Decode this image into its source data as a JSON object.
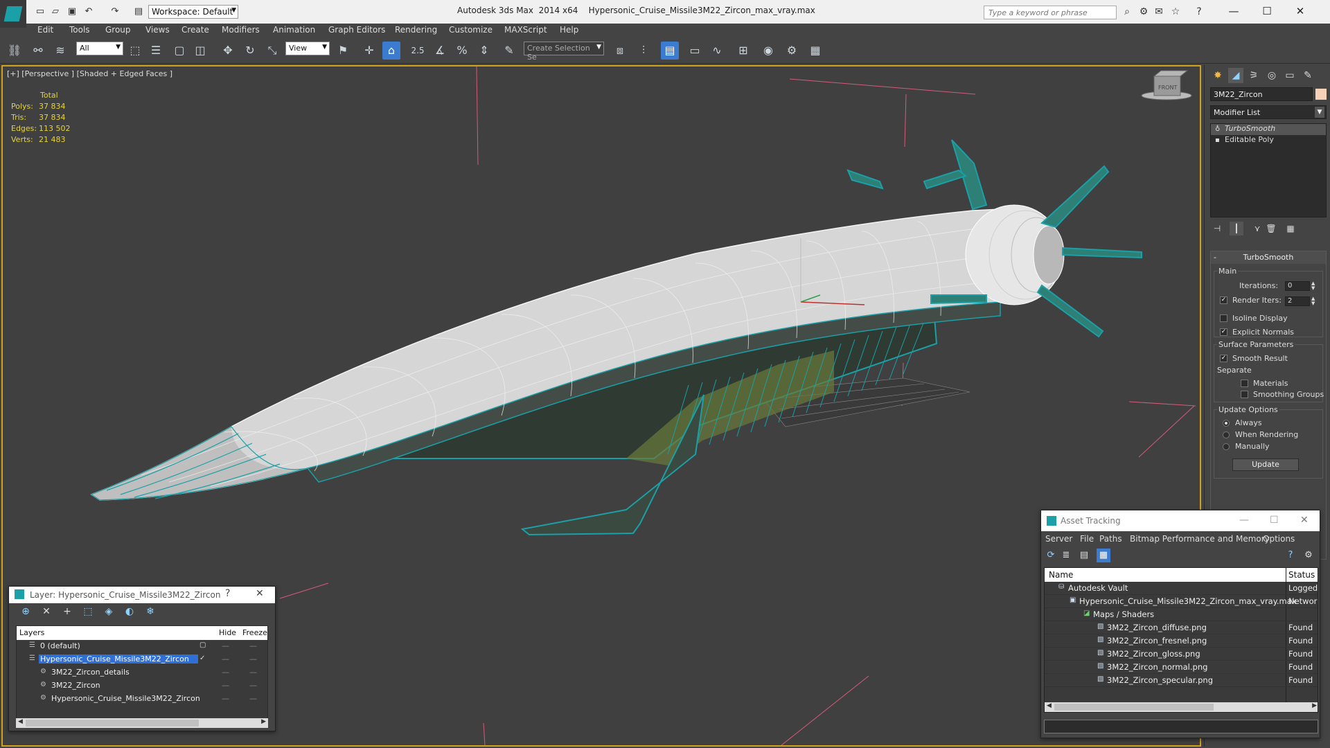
{
  "app": {
    "title": "Autodesk 3ds Max  2014 x64",
    "file": "Hypersonic_Cruise_Missile3M22_Zircon_max_vray.max",
    "workspace": "Workspace: Default",
    "search_placeholder": "Type a keyword or phrase"
  },
  "menu": [
    "Edit",
    "Tools",
    "Group",
    "Views",
    "Create",
    "Modifiers",
    "Animation",
    "Graph Editors",
    "Rendering",
    "Customize",
    "MAXScript",
    "Help"
  ],
  "toolbar": {
    "filter": "All",
    "ref_coord": "View",
    "snap_angle": "2.5",
    "selection_set": "Create Selection Se"
  },
  "viewport": {
    "label": "[+] [Perspective ] [Shaded + Edged Faces ]",
    "stats_header": "Total",
    "stats": [
      {
        "label": "Polys:",
        "value": "37 834"
      },
      {
        "label": "Tris:",
        "value": "37 834"
      },
      {
        "label": "Edges:",
        "value": "113 502"
      },
      {
        "label": "Verts:",
        "value": "21 483"
      }
    ],
    "viewcube": "FRONT"
  },
  "command_panel": {
    "object_name": "3M22_Zircon",
    "modifier_list": "Modifier List",
    "stack": [
      "TurboSmooth",
      "Editable Poly"
    ],
    "rollout_title": "TurboSmooth",
    "main_group": "Main",
    "iterations_label": "Iterations:",
    "iterations_value": "0",
    "render_iters_label": "Render Iters:",
    "render_iters_value": "2",
    "isoline_label": "Isoline Display",
    "explicit_normals_label": "Explicit Normals",
    "surface_group": "Surface Parameters",
    "smooth_result_label": "Smooth Result",
    "separate_label": "Separate",
    "materials_label": "Materials",
    "smoothing_groups_label": "Smoothing Groups",
    "update_group": "Update Options",
    "always_label": "Always",
    "when_rendering_label": "When Rendering",
    "manually_label": "Manually",
    "update_button": "Update"
  },
  "layer_dialog": {
    "title": "Layer: Hypersonic_Cruise_Missile3M22_Zircon",
    "help": "?",
    "col_layers": "Layers",
    "col_hide": "Hide",
    "col_freeze": "Freeze",
    "rows": [
      {
        "name": "0 (default)"
      },
      {
        "name": "Hypersonic_Cruise_Missile3M22_Zircon"
      },
      {
        "name": "3M22_Zircon_details"
      },
      {
        "name": "3M22_Zircon"
      },
      {
        "name": "Hypersonic_Cruise_Missile3M22_Zircon"
      }
    ]
  },
  "asset_dialog": {
    "title": "Asset Tracking",
    "menu": [
      "Server",
      "File",
      "Paths",
      "Bitmap Performance and Memory",
      "Options"
    ],
    "col_name": "Name",
    "col_status": "Status",
    "rows": [
      {
        "name": "Autodesk Vault",
        "status": "Logged"
      },
      {
        "name": "Hypersonic_Cruise_Missile3M22_Zircon_max_vray.max",
        "status": "Network"
      },
      {
        "name": "Maps / Shaders",
        "status": ""
      },
      {
        "name": "3M22_Zircon_diffuse.png",
        "status": "Found"
      },
      {
        "name": "3M22_Zircon_fresnel.png",
        "status": "Found"
      },
      {
        "name": "3M22_Zircon_gloss.png",
        "status": "Found"
      },
      {
        "name": "3M22_Zircon_normal.png",
        "status": "Found"
      },
      {
        "name": "3M22_Zircon_specular.png",
        "status": "Found"
      }
    ]
  },
  "colors": {
    "accent": "#1aa0a6",
    "viewport_border": "#d4a11a",
    "stats": "#e6d33a",
    "selection": "#2f6fd6"
  }
}
